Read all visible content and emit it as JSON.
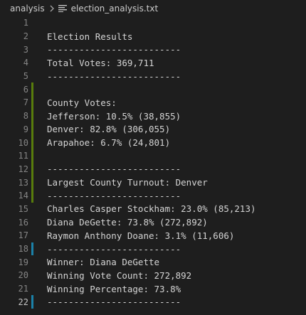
{
  "breadcrumb": {
    "folder": "analysis",
    "separator_icon": "chevron-right-icon",
    "file_icon": "text-file-icon",
    "file": "election_analysis.txt"
  },
  "colors": {
    "background": "#1e1e1e",
    "text": "#d4d4d4",
    "line_number": "#858585",
    "modified_marker": "#587c0c",
    "added_marker": "#1b81a8"
  },
  "editor": {
    "lines": [
      {
        "num": "1",
        "text": ""
      },
      {
        "num": "2",
        "text": "Election Results"
      },
      {
        "num": "3",
        "text": "-------------------------"
      },
      {
        "num": "4",
        "text": "Total Votes: 369,711"
      },
      {
        "num": "5",
        "text": "-------------------------"
      },
      {
        "num": "6",
        "text": ""
      },
      {
        "num": "7",
        "text": "County Votes:"
      },
      {
        "num": "8",
        "text": "Jefferson: 10.5% (38,855)"
      },
      {
        "num": "9",
        "text": "Denver: 82.8% (306,055)"
      },
      {
        "num": "10",
        "text": "Arapahoe: 6.7% (24,801)"
      },
      {
        "num": "11",
        "text": ""
      },
      {
        "num": "12",
        "text": "-------------------------"
      },
      {
        "num": "13",
        "text": "Largest County Turnout: Denver"
      },
      {
        "num": "14",
        "text": "-------------------------"
      },
      {
        "num": "15",
        "text": "Charles Casper Stockham: 23.0% (85,213)"
      },
      {
        "num": "16",
        "text": "Diana DeGette: 73.8% (272,892)"
      },
      {
        "num": "17",
        "text": "Raymon Anthony Doane: 3.1% (11,606)"
      },
      {
        "num": "18",
        "text": "-------------------------"
      },
      {
        "num": "19",
        "text": "Winner: Diana DeGette"
      },
      {
        "num": "20",
        "text": "Winning Vote Count: 272,892"
      },
      {
        "num": "21",
        "text": "Winning Percentage: 73.8%"
      },
      {
        "num": "22",
        "text": "-------------------------"
      }
    ]
  }
}
